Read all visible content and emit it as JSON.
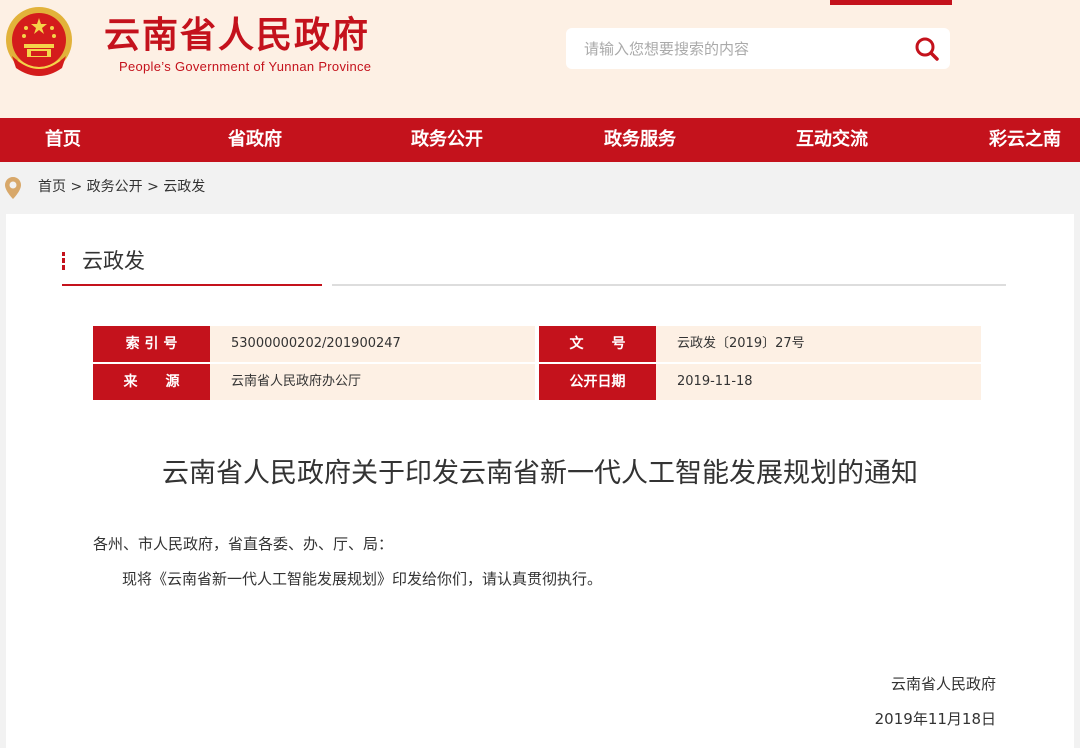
{
  "header": {
    "title": "云南省人民政府",
    "subtitle": "People’s Government of Yunnan Province",
    "search_placeholder": "请输入您想要搜索的内容",
    "emblem_icon": "national-emblem-icon",
    "search_icon": "search-icon"
  },
  "nav": {
    "items": [
      {
        "label": "首页"
      },
      {
        "label": "省政府"
      },
      {
        "label": "政务公开"
      },
      {
        "label": "政务服务"
      },
      {
        "label": "互动交流"
      },
      {
        "label": "彩云之南"
      }
    ]
  },
  "breadcrumb": {
    "icon": "location-pin-icon",
    "items": [
      "首页",
      "政务公开",
      "云政发"
    ],
    "separator": ">"
  },
  "section": {
    "title": "云政发"
  },
  "meta": {
    "index_label": "索 引 号",
    "index_value": "53000000202/201900247",
    "docno_label": "文　　号",
    "docno_value": "云政发〔2019〕27号",
    "source_label": "来　　源",
    "source_value": "云南省人民政府办公厅",
    "date_label": "公开日期",
    "date_value": "2019-11-18"
  },
  "document": {
    "title": "云南省人民政府关于印发云南省新一代人工智能发展规划的通知",
    "salutation": "各州、市人民政府，省直各委、办、厅、局：",
    "body": "现将《云南省新一代人工智能发展规划》印发给你们，请认真贯彻执行。",
    "signer": "云南省人民政府",
    "date": "2019年11月18日"
  },
  "colors": {
    "brand_red": "#c4121c",
    "header_bg": "#fdf0e4",
    "meta_value_bg": "#fdf0e4"
  }
}
